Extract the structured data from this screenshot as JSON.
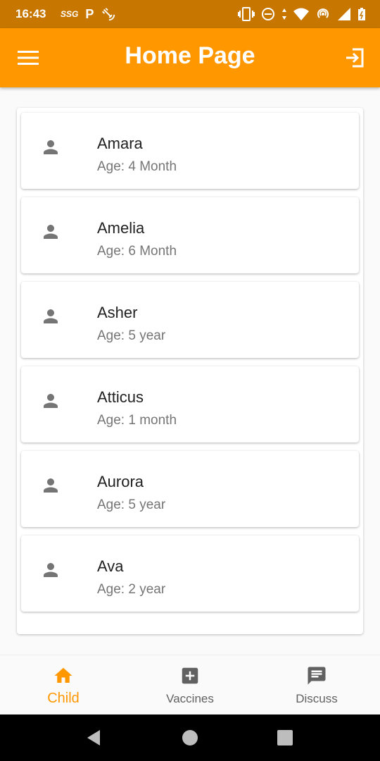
{
  "status_bar": {
    "time": "16:43",
    "left_text": "SSG",
    "left_p": "P"
  },
  "app_bar": {
    "title": "Home Page",
    "background": "#ff9800"
  },
  "children": [
    {
      "name": "Amara",
      "age": "Age: 4 Month"
    },
    {
      "name": "Amelia",
      "age": "Age: 6 Month"
    },
    {
      "name": "Asher",
      "age": "Age: 5 year"
    },
    {
      "name": "Atticus",
      "age": "Age: 1 month"
    },
    {
      "name": "Aurora",
      "age": "Age: 5 year"
    },
    {
      "name": "Ava",
      "age": "Age: 2 year"
    }
  ],
  "bottom_nav": {
    "items": [
      {
        "label": "Child",
        "icon": "home-icon",
        "active": true
      },
      {
        "label": "Vaccines",
        "icon": "medical-plus-icon",
        "active": false
      },
      {
        "label": "Discuss",
        "icon": "chat-icon",
        "active": false
      }
    ],
    "active_color": "#ff9800",
    "inactive_color": "#616161"
  }
}
